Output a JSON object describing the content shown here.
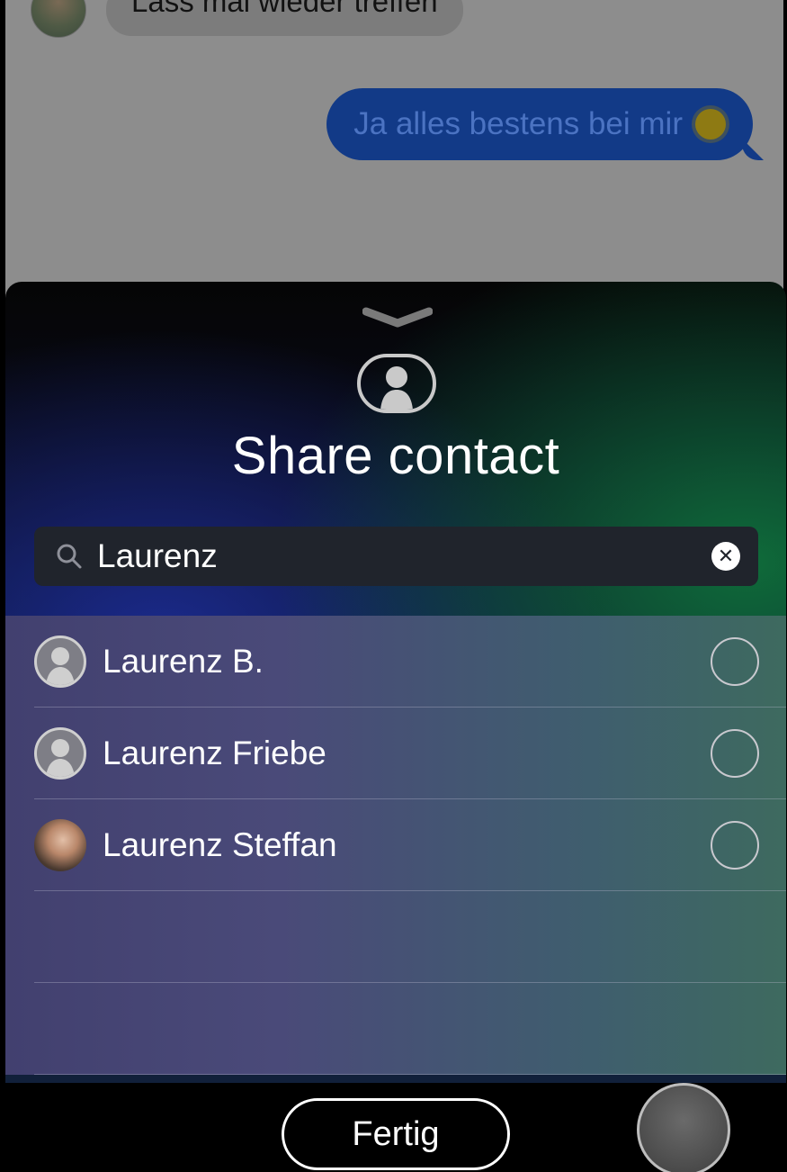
{
  "chat": {
    "incoming_message": "Lass mal wieder treffen",
    "outgoing_message": "Ja alles bestens bei mir",
    "outgoing_emoji_icon": "sun-icon"
  },
  "share_sheet": {
    "title": "Share contact",
    "search": {
      "value": "Laurenz",
      "placeholder": ""
    },
    "contacts": [
      {
        "name": "Laurenz B.",
        "avatar": "placeholder",
        "selected": false
      },
      {
        "name": "Laurenz Friebe",
        "avatar": "placeholder",
        "selected": false
      },
      {
        "name": "Laurenz Steffan",
        "avatar": "photo",
        "selected": false
      }
    ],
    "done_label": "Fertig"
  },
  "colors": {
    "outgoing_bubble": "#123a87",
    "list_left": "#42406f",
    "list_right": "#3e6a5f"
  }
}
